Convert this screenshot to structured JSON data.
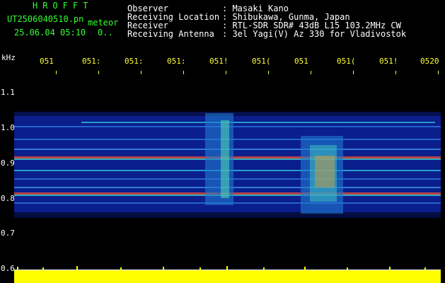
{
  "header": {
    "title": "HROFFT",
    "filename": "UT2506040510.pn",
    "filename_suffix": "meteor",
    "datetime": "25.06.04 05:10",
    "datetime_extra": "0..",
    "info": [
      {
        "label": "Observer",
        "value": ": Masaki Kano"
      },
      {
        "label": "Receiving Location",
        "value": ": Shibukawa, Gunma, Japan"
      },
      {
        "label": "Receiver",
        "value": ": RTL-SDR SDR# 43dB L15 103.2MHz CW"
      },
      {
        "label": "Receiving Antenna",
        "value": ": 3el Yagi(V) Az 330 for Vladivostok"
      }
    ]
  },
  "axis": {
    "unit": "kHz",
    "y_ticks": [
      "1.1",
      "1.0",
      "0.9",
      "0.8",
      "0.7",
      "0.6"
    ],
    "x_ticks": [
      "051",
      "051:",
      "051:",
      "051:",
      "051!",
      "051(",
      "051",
      "051(",
      "051!",
      "0520"
    ]
  },
  "colors": {
    "background": "#000000",
    "text_green": "#33ff33",
    "text_white": "#ffffff",
    "tick_yellow": "#ffff33",
    "spectrogram_bg": "#0a1e8c",
    "amplitude": "#ffff00"
  }
}
